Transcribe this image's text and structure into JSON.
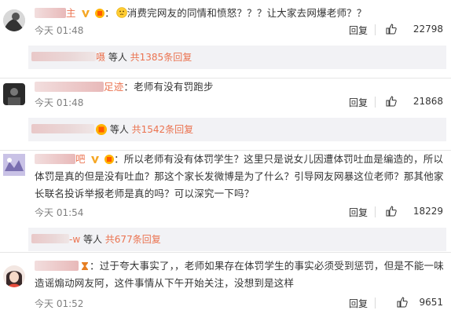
{
  "comments": [
    {
      "username_suffix": "主",
      "text": "消费完网友的同情和愤怒？？？让大家去网爆老师？？",
      "time": "今天 01:48",
      "reply_label": "回复",
      "likes": "22798",
      "reply_preview": {
        "suffix": "嗫",
        "text_pre": " 等人 ",
        "count": "共1385条回复"
      }
    },
    {
      "username_suffix": "足迹",
      "text": "老师有没有罚跑步",
      "time": "今天 01:48",
      "reply_label": "回复",
      "likes": "21868",
      "reply_preview": {
        "suffix": "",
        "text_pre": " 等人 ",
        "count": "共1542条回复"
      }
    },
    {
      "username_suffix": "吧",
      "text": "所以老师有没有体罚学生？这里只是说女儿因遭体罚吐血是编造的，所以体罚是真的但是没有吐血？那这个家长发微博是为了什么？引导网友网暴这位老师？那其他家长联名投诉举报老师是真的吗？可以深究一下吗？",
      "time": "今天 01:54",
      "reply_label": "回复",
      "likes": "18229",
      "reply_preview": {
        "suffix": "-w",
        "text_pre": " 等人 ",
        "count": "共677条回复"
      }
    },
    {
      "username_suffix": "",
      "text": "过于夸大事实了，，老师如果存在体罚学生的事实必须受到惩罚，但是不能一味造谣煽动网友阿，这件事情从下午开始关注，没想到是这样",
      "time": "今天 01:52",
      "reply_label": "回复",
      "likes": "9651"
    }
  ],
  "icons": {
    "like": "thumbs-up-icon",
    "vip": "vip-badge-icon",
    "emoji": "thinking-emoji-icon"
  },
  "colors": {
    "accent": "#eb7350",
    "reply_bg": "#f2f2f5"
  }
}
